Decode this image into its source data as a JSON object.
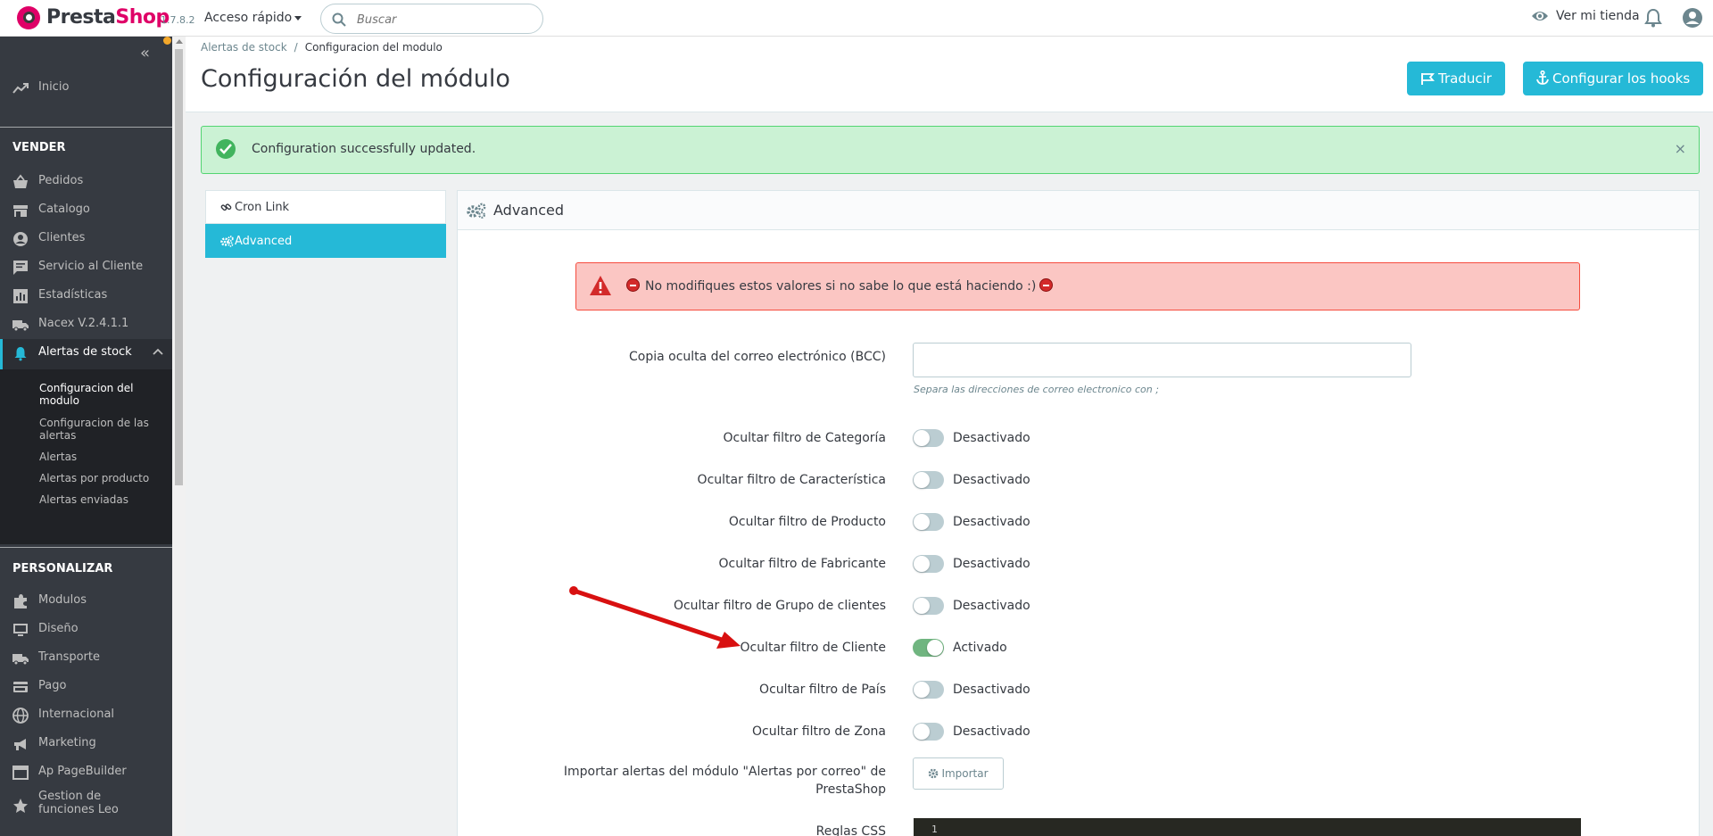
{
  "header": {
    "logo_prefix": "Presta",
    "logo_suffix": "Shop",
    "version": "1.7.8.2",
    "quick_access": "Acceso rápido",
    "search_placeholder": "Buscar",
    "view_store": "Ver mi tienda"
  },
  "sidebar": {
    "home": "Inicio",
    "section_sell": "VENDER",
    "sell_items": [
      "Pedidos",
      "Catalogo",
      "Clientes",
      "Servicio al Cliente",
      "Estadísticas",
      "Nacex V.2.4.1.1",
      "Alertas de stock"
    ],
    "sub_items": [
      "Configuracion del modulo",
      "Configuracion de las alertas",
      "Alertas",
      "Alertas por producto",
      "Alertas enviadas"
    ],
    "section_customize": "PERSONALIZAR",
    "customize_items": [
      "Modulos",
      "Diseño",
      "Transporte",
      "Pago",
      "Internacional",
      "Marketing",
      "Ap PageBuilder",
      "Gestion de funciones Leo"
    ]
  },
  "breadcrumb": {
    "parent": "Alertas de stock",
    "separator": "/",
    "current": "Configuracion del modulo"
  },
  "page_title": "Configuración del módulo",
  "toolbar": {
    "translate": "Traducir",
    "hooks": "Configurar los hooks"
  },
  "success_alert": {
    "message": "Configuration successfully updated.",
    "close": "×"
  },
  "tabs": [
    "Cron Link",
    "Advanced"
  ],
  "panel_title": "Advanced",
  "warning": "No modifiques estos valores si no sabe lo que está haciendo :)",
  "bcc": {
    "label": "Copia oculta del correo electrónico (BCC)",
    "value": "",
    "help": "Separa las direcciones de correo electronico con ;"
  },
  "toggles": [
    {
      "label": "Ocultar filtro de Categoría",
      "state": "Desactivado",
      "on": false
    },
    {
      "label": "Ocultar filtro de Característica",
      "state": "Desactivado",
      "on": false
    },
    {
      "label": "Ocultar filtro de Producto",
      "state": "Desactivado",
      "on": false
    },
    {
      "label": "Ocultar filtro de Fabricante",
      "state": "Desactivado",
      "on": false
    },
    {
      "label": "Ocultar filtro de Grupo de clientes",
      "state": "Desactivado",
      "on": false
    },
    {
      "label": "Ocultar filtro de Cliente",
      "state": "Activado",
      "on": true
    },
    {
      "label": "Ocultar filtro de País",
      "state": "Desactivado",
      "on": false
    },
    {
      "label": "Ocultar filtro de Zona",
      "state": "Desactivado",
      "on": false
    }
  ],
  "import": {
    "label_line1": "Importar alertas del módulo \"Alertas por correo\" de",
    "label_line2": "PrestaShop",
    "button": "Importar"
  },
  "css_rules": {
    "label": "Reglas CSS",
    "line_number": "1"
  },
  "colors": {
    "accent": "#25b9d7",
    "success_bg": "#cbf2d4",
    "danger_bg": "#fbc6c3",
    "switch_on": "#70b580",
    "annotation_arrow": "#d81010"
  }
}
